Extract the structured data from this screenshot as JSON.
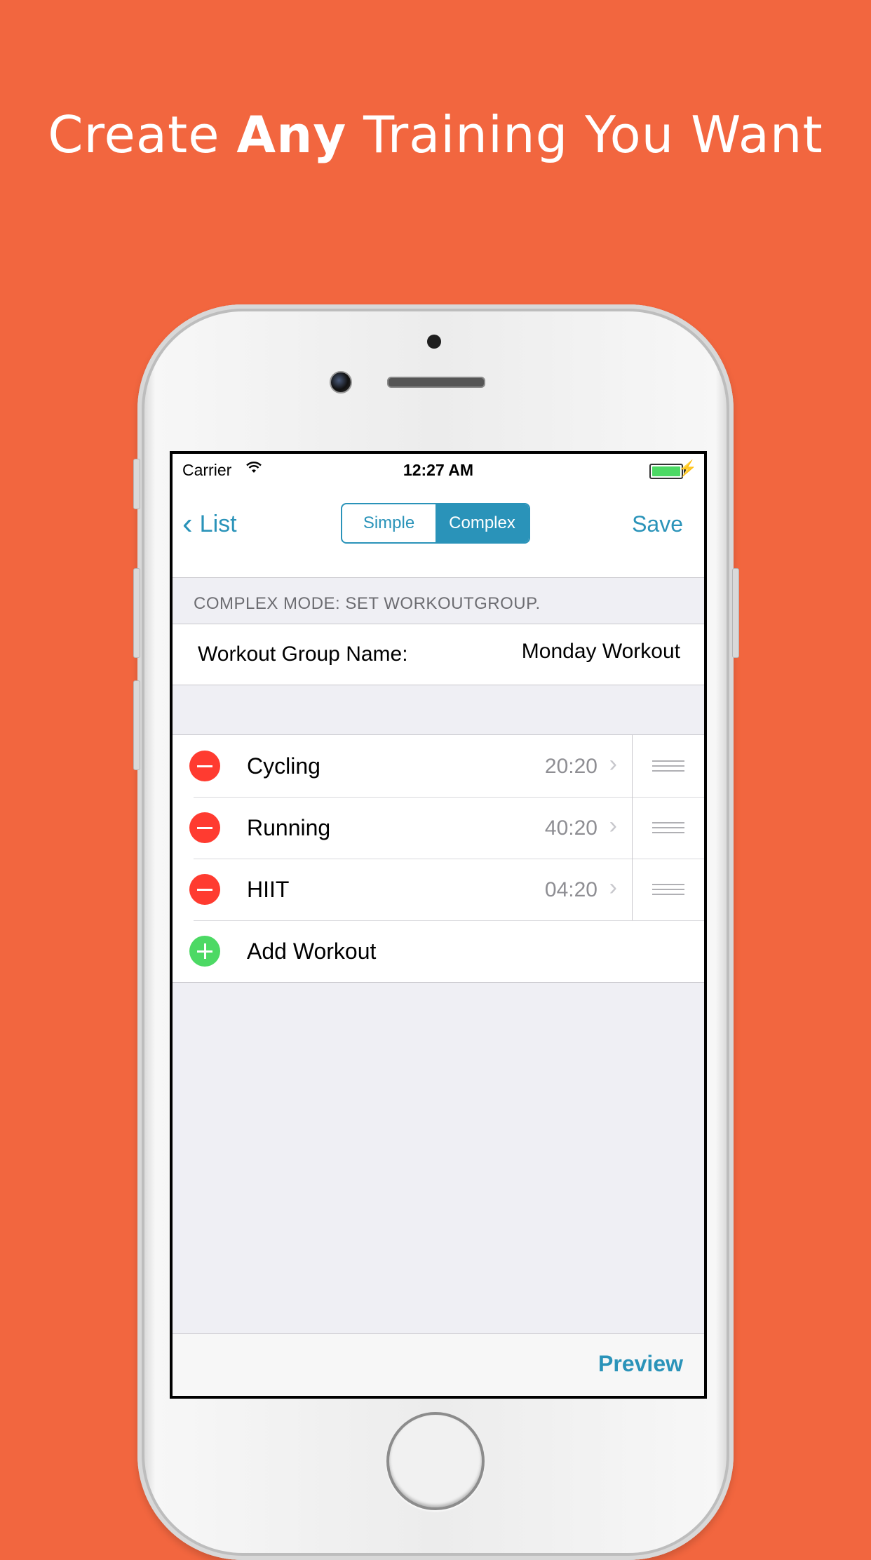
{
  "headline": {
    "prefix": "Create ",
    "emphasis": "Any",
    "suffix": " Training You Want"
  },
  "colors": {
    "background": "#F2663F",
    "accent": "#2A93B9",
    "delete": "#FF3B30",
    "add": "#4CD964"
  },
  "status_bar": {
    "carrier": "Carrier",
    "time": "12:27 AM"
  },
  "nav": {
    "back_label": "List",
    "segments": [
      "Simple",
      "Complex"
    ],
    "selected_segment": "Complex",
    "save_label": "Save"
  },
  "section_header": "COMPLEX MODE: SET WORKOUTGROUP.",
  "group": {
    "label": "Workout Group Name:",
    "value": "Monday Workout"
  },
  "workouts": [
    {
      "name": "Cycling",
      "time": "20:20"
    },
    {
      "name": "Running",
      "time": "40:20"
    },
    {
      "name": "HIIT",
      "time": "04:20"
    }
  ],
  "add_workout_label": "Add Workout",
  "toolbar": {
    "preview_label": "Preview"
  }
}
